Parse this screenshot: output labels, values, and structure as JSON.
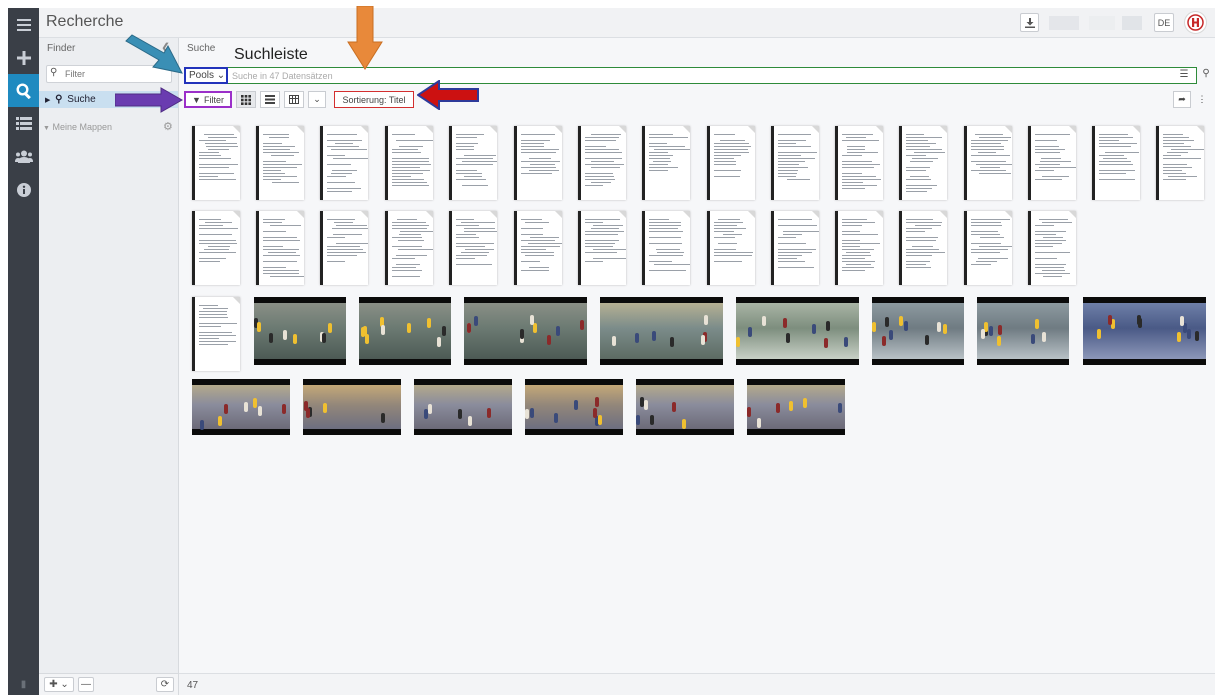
{
  "header": {
    "title": "Recherche",
    "language": "DE",
    "download_icon": "download-icon",
    "logo_icon": "university-seal-icon"
  },
  "rail": {
    "items": [
      {
        "icon": "menu-icon"
      },
      {
        "icon": "plus-icon"
      },
      {
        "icon": "search-icon"
      },
      {
        "icon": "list-icon"
      },
      {
        "icon": "users-icon"
      },
      {
        "icon": "info-icon"
      }
    ]
  },
  "finder": {
    "label": "Finder",
    "filter_placeholder": "Filter",
    "search_item": "Suche",
    "my_folders": "Meine Mappen"
  },
  "main": {
    "label": "Suche",
    "annotation_label": "Suchleiste",
    "pools_label": "Pools",
    "search_placeholder": "Suche in 47 Datensätzen",
    "filter_label": "Filter",
    "sort_label": "Sortierung: Titel",
    "result_count": "47"
  },
  "colors": {
    "accent": "#1f8ac0",
    "rail": "#3a3f47",
    "annotation_green": "#2e8b3a",
    "annotation_blue": "#2233bb",
    "annotation_purple": "#9b2fc9",
    "annotation_red": "#d32f2f",
    "arrow_orange": "#e8893a",
    "arrow_teal": "#3a8fb5",
    "arrow_purple": "#6a3cb0",
    "arrow_red": "#cc1111"
  },
  "thumbnails": {
    "documents": 31,
    "videos": 16
  }
}
